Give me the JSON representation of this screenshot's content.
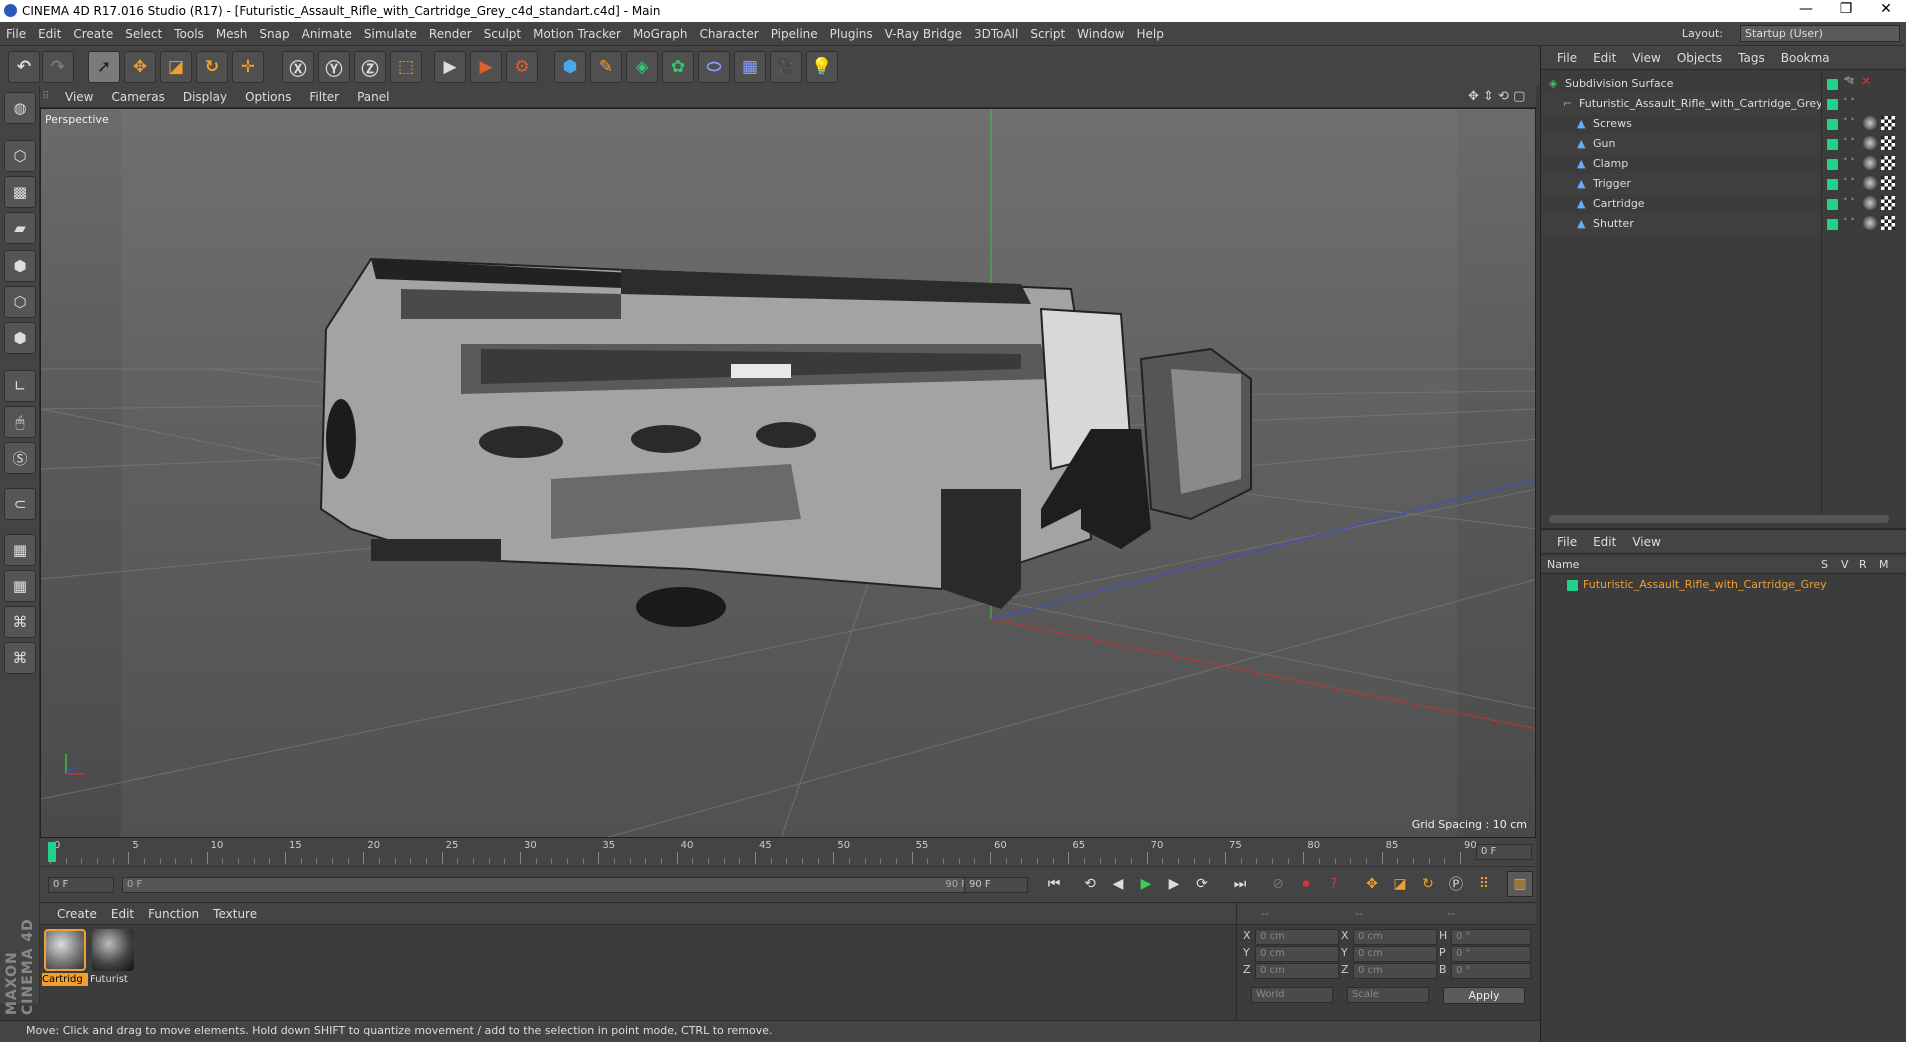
{
  "window": {
    "title": "CINEMA 4D R17.016 Studio (R17) - [Futuristic_Assault_Rifle_with_Cartridge_Grey_c4d_standart.c4d] - Main",
    "min": "—",
    "max": "❐",
    "close": "✕"
  },
  "menu": [
    "File",
    "Edit",
    "Create",
    "Select",
    "Tools",
    "Mesh",
    "Snap",
    "Animate",
    "Simulate",
    "Render",
    "Sculpt",
    "Motion Tracker",
    "MoGraph",
    "Character",
    "Pipeline",
    "Plugins",
    "V-Ray Bridge",
    "3DToAll",
    "Script",
    "Window",
    "Help"
  ],
  "layout": {
    "label": "Layout:",
    "value": "Startup (User)"
  },
  "viewport": {
    "menu": [
      "View",
      "Cameras",
      "Display",
      "Options",
      "Filter",
      "Panel"
    ],
    "label": "Perspective",
    "grid_spacing": "Grid Spacing : 10 cm"
  },
  "timeline": {
    "ticks": [
      "0",
      "5",
      "10",
      "15",
      "20",
      "25",
      "30",
      "35",
      "40",
      "45",
      "50",
      "55",
      "60",
      "65",
      "70",
      "75",
      "80",
      "85",
      "90"
    ],
    "current_frame": "0 F",
    "start": "0 F",
    "range_start": "0 F",
    "range_end": "90 F",
    "end": "90 F"
  },
  "materials": {
    "menu": [
      "Create",
      "Edit",
      "Function",
      "Texture"
    ],
    "items": [
      {
        "name": "Cartridg",
        "selected": true
      },
      {
        "name": "Futurist",
        "selected": false
      }
    ]
  },
  "coords": {
    "headers": [
      "--",
      "--",
      "--"
    ],
    "rows": [
      {
        "a": "X",
        "v1": "0 cm",
        "b": "X",
        "v2": "0 cm",
        "c": "H",
        "v3": "0 °"
      },
      {
        "a": "Y",
        "v1": "0 cm",
        "b": "Y",
        "v2": "0 cm",
        "c": "P",
        "v3": "0 °"
      },
      {
        "a": "Z",
        "v1": "0 cm",
        "b": "Z",
        "v2": "0 cm",
        "c": "B",
        "v3": "0 °"
      }
    ],
    "mode1": "World",
    "mode2": "Scale",
    "apply": "Apply"
  },
  "objects": {
    "menu": [
      "File",
      "Edit",
      "View",
      "Objects",
      "Tags",
      "Bookma"
    ],
    "items": [
      {
        "name": "Subdivision Surface",
        "indent": 0
      },
      {
        "name": "Futuristic_Assault_Rifle_with_Cartridge_Grey",
        "indent": 1
      },
      {
        "name": "Screws",
        "indent": 2
      },
      {
        "name": "Gun",
        "indent": 2
      },
      {
        "name": "Clamp",
        "indent": 2
      },
      {
        "name": "Trigger",
        "indent": 2
      },
      {
        "name": "Cartridge",
        "indent": 2
      },
      {
        "name": "Shutter",
        "indent": 2
      }
    ]
  },
  "attributes": {
    "menu": [
      "File",
      "Edit",
      "View"
    ],
    "columns": {
      "name": "Name",
      "s": "S",
      "v": "V",
      "r": "R",
      "m": "M"
    },
    "row": "Futuristic_Assault_Rifle_with_Cartridge_Grey"
  },
  "status": "Move: Click and drag to move elements. Hold down SHIFT to quantize movement / add to the selection in point mode, CTRL to remove.",
  "brand": "MAXON CINEMA 4D",
  "colors": {
    "accent": "#f0a030",
    "tag": "#23d28a",
    "selected_text": "#f0a030"
  }
}
